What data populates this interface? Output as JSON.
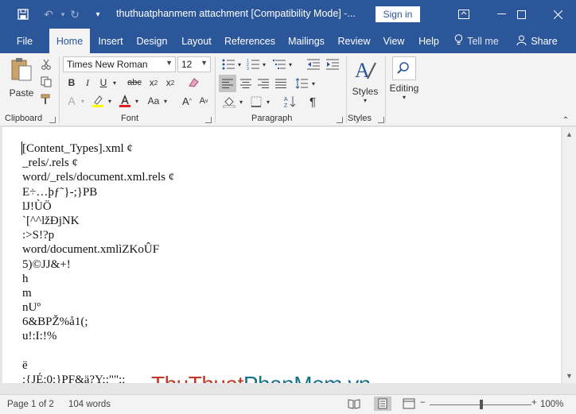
{
  "titlebar": {
    "title": "thuthuatphanmem attachment [Compatibility Mode]  -...",
    "signin_label": "Sign in",
    "bg_color": "#2b579a"
  },
  "tabs": {
    "file": "File",
    "home": "Home",
    "insert": "Insert",
    "design": "Design",
    "layout": "Layout",
    "references": "References",
    "mailings": "Mailings",
    "review": "Review",
    "view": "View",
    "help": "Help",
    "tellme": "Tell me",
    "share": "Share"
  },
  "ribbon": {
    "clipboard": {
      "label": "Clipboard",
      "paste": "Paste"
    },
    "font": {
      "label": "Font",
      "name": "Times New Roman",
      "size": "12"
    },
    "paragraph": {
      "label": "Paragraph"
    },
    "styles": {
      "label": "Styles",
      "button": "Styles"
    },
    "editing": {
      "button": "Editing"
    }
  },
  "document": {
    "lines": [
      "[Content_Types].xml ¢",
      "_rels/.rels ¢",
      "word/_rels/document.xml.rels ¢",
      "E÷…þƒ˜}-;}PB",
      "lJ!ÙÖ",
      "`[^^lžĐjNK",
      ":>S!?p",
      "word/document.xmlìZKoÛF",
      "5)©JJ&+!",
      "h",
      "m",
      "nUº",
      "6&BPŽ%å1(;",
      "u!:I:!%",
      "",
      "ë",
      ";{JÉ;0;}PF&ä?Y;;\"\";;"
    ]
  },
  "watermark": {
    "part1": "Thu",
    "part2": "Thuat",
    "part3": "PhanMem",
    "part4": ".vn",
    "red": "#c0392b",
    "teal": "#17718a"
  },
  "statusbar": {
    "page": "Page 1 of 2",
    "words": "104 words",
    "zoom": "100%"
  }
}
